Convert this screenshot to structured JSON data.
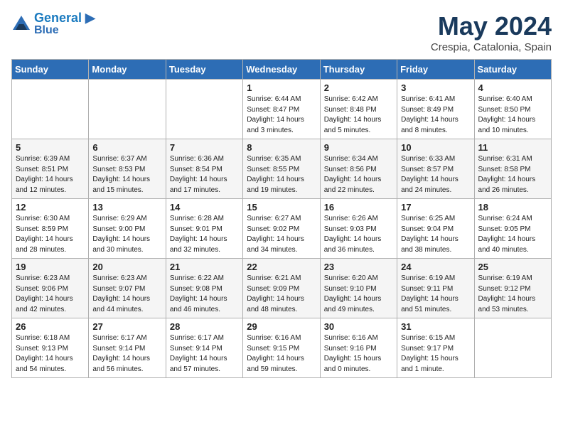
{
  "header": {
    "logo_line1": "General",
    "logo_line2": "Blue",
    "month": "May 2024",
    "location": "Crespia, Catalonia, Spain"
  },
  "weekdays": [
    "Sunday",
    "Monday",
    "Tuesday",
    "Wednesday",
    "Thursday",
    "Friday",
    "Saturday"
  ],
  "weeks": [
    [
      {
        "day": "",
        "info": ""
      },
      {
        "day": "",
        "info": ""
      },
      {
        "day": "",
        "info": ""
      },
      {
        "day": "1",
        "info": "Sunrise: 6:44 AM\nSunset: 8:47 PM\nDaylight: 14 hours\nand 3 minutes."
      },
      {
        "day": "2",
        "info": "Sunrise: 6:42 AM\nSunset: 8:48 PM\nDaylight: 14 hours\nand 5 minutes."
      },
      {
        "day": "3",
        "info": "Sunrise: 6:41 AM\nSunset: 8:49 PM\nDaylight: 14 hours\nand 8 minutes."
      },
      {
        "day": "4",
        "info": "Sunrise: 6:40 AM\nSunset: 8:50 PM\nDaylight: 14 hours\nand 10 minutes."
      }
    ],
    [
      {
        "day": "5",
        "info": "Sunrise: 6:39 AM\nSunset: 8:51 PM\nDaylight: 14 hours\nand 12 minutes."
      },
      {
        "day": "6",
        "info": "Sunrise: 6:37 AM\nSunset: 8:53 PM\nDaylight: 14 hours\nand 15 minutes."
      },
      {
        "day": "7",
        "info": "Sunrise: 6:36 AM\nSunset: 8:54 PM\nDaylight: 14 hours\nand 17 minutes."
      },
      {
        "day": "8",
        "info": "Sunrise: 6:35 AM\nSunset: 8:55 PM\nDaylight: 14 hours\nand 19 minutes."
      },
      {
        "day": "9",
        "info": "Sunrise: 6:34 AM\nSunset: 8:56 PM\nDaylight: 14 hours\nand 22 minutes."
      },
      {
        "day": "10",
        "info": "Sunrise: 6:33 AM\nSunset: 8:57 PM\nDaylight: 14 hours\nand 24 minutes."
      },
      {
        "day": "11",
        "info": "Sunrise: 6:31 AM\nSunset: 8:58 PM\nDaylight: 14 hours\nand 26 minutes."
      }
    ],
    [
      {
        "day": "12",
        "info": "Sunrise: 6:30 AM\nSunset: 8:59 PM\nDaylight: 14 hours\nand 28 minutes."
      },
      {
        "day": "13",
        "info": "Sunrise: 6:29 AM\nSunset: 9:00 PM\nDaylight: 14 hours\nand 30 minutes."
      },
      {
        "day": "14",
        "info": "Sunrise: 6:28 AM\nSunset: 9:01 PM\nDaylight: 14 hours\nand 32 minutes."
      },
      {
        "day": "15",
        "info": "Sunrise: 6:27 AM\nSunset: 9:02 PM\nDaylight: 14 hours\nand 34 minutes."
      },
      {
        "day": "16",
        "info": "Sunrise: 6:26 AM\nSunset: 9:03 PM\nDaylight: 14 hours\nand 36 minutes."
      },
      {
        "day": "17",
        "info": "Sunrise: 6:25 AM\nSunset: 9:04 PM\nDaylight: 14 hours\nand 38 minutes."
      },
      {
        "day": "18",
        "info": "Sunrise: 6:24 AM\nSunset: 9:05 PM\nDaylight: 14 hours\nand 40 minutes."
      }
    ],
    [
      {
        "day": "19",
        "info": "Sunrise: 6:23 AM\nSunset: 9:06 PM\nDaylight: 14 hours\nand 42 minutes."
      },
      {
        "day": "20",
        "info": "Sunrise: 6:23 AM\nSunset: 9:07 PM\nDaylight: 14 hours\nand 44 minutes."
      },
      {
        "day": "21",
        "info": "Sunrise: 6:22 AM\nSunset: 9:08 PM\nDaylight: 14 hours\nand 46 minutes."
      },
      {
        "day": "22",
        "info": "Sunrise: 6:21 AM\nSunset: 9:09 PM\nDaylight: 14 hours\nand 48 minutes."
      },
      {
        "day": "23",
        "info": "Sunrise: 6:20 AM\nSunset: 9:10 PM\nDaylight: 14 hours\nand 49 minutes."
      },
      {
        "day": "24",
        "info": "Sunrise: 6:19 AM\nSunset: 9:11 PM\nDaylight: 14 hours\nand 51 minutes."
      },
      {
        "day": "25",
        "info": "Sunrise: 6:19 AM\nSunset: 9:12 PM\nDaylight: 14 hours\nand 53 minutes."
      }
    ],
    [
      {
        "day": "26",
        "info": "Sunrise: 6:18 AM\nSunset: 9:13 PM\nDaylight: 14 hours\nand 54 minutes."
      },
      {
        "day": "27",
        "info": "Sunrise: 6:17 AM\nSunset: 9:14 PM\nDaylight: 14 hours\nand 56 minutes."
      },
      {
        "day": "28",
        "info": "Sunrise: 6:17 AM\nSunset: 9:14 PM\nDaylight: 14 hours\nand 57 minutes."
      },
      {
        "day": "29",
        "info": "Sunrise: 6:16 AM\nSunset: 9:15 PM\nDaylight: 14 hours\nand 59 minutes."
      },
      {
        "day": "30",
        "info": "Sunrise: 6:16 AM\nSunset: 9:16 PM\nDaylight: 15 hours\nand 0 minutes."
      },
      {
        "day": "31",
        "info": "Sunrise: 6:15 AM\nSunset: 9:17 PM\nDaylight: 15 hours\nand 1 minute."
      },
      {
        "day": "",
        "info": ""
      }
    ]
  ]
}
